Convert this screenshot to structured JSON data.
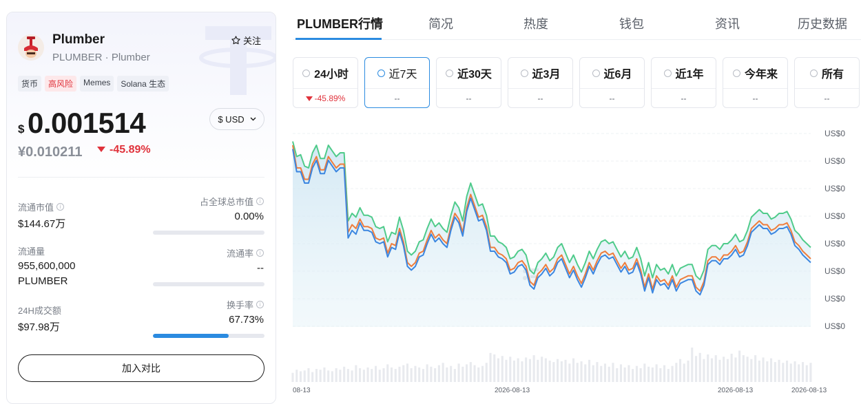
{
  "coin": {
    "name": "Plumber",
    "subtitle": "PLUMBER · Plumber",
    "follow_label": "关注",
    "tags": [
      {
        "label": "货币",
        "kind": "normal"
      },
      {
        "label": "高风险",
        "kind": "risk"
      },
      {
        "label": "Memes",
        "kind": "normal"
      },
      {
        "label": "Solana 生态",
        "kind": "normal"
      }
    ],
    "currency_symbol": "$",
    "price": "0.001514",
    "currency_select": "$ USD",
    "price_cny": "¥0.010211",
    "change_24h": "-45.89%"
  },
  "stats": {
    "market_cap_label": "流通市值",
    "market_cap_value": "$144.67万",
    "global_share_label": "占全球总市值",
    "global_share_value": "0.00%",
    "global_share_progress": 0,
    "circulating_label": "流通量",
    "circulating_value_1": "955,600,000",
    "circulating_value_2": "PLUMBER",
    "circulating_rate_label": "流通率",
    "circulating_rate_value": "--",
    "circulating_rate_progress": 0,
    "volume_label": "24H成交额",
    "volume_value": "$97.98万",
    "turnover_label": "换手率",
    "turnover_value": "67.73%",
    "turnover_progress": 0.6773
  },
  "compare_button": "加入对比",
  "tabs": [
    {
      "label": "PLUMBER行情",
      "active": true
    },
    {
      "label": "简况",
      "active": false
    },
    {
      "label": "热度",
      "active": false
    },
    {
      "label": "钱包",
      "active": false
    },
    {
      "label": "资讯",
      "active": false
    },
    {
      "label": "历史数据",
      "active": false
    }
  ],
  "periods": [
    {
      "label": "24小时",
      "value": "-45.89%",
      "negative": true,
      "active": false
    },
    {
      "label": "近7天",
      "value": "--",
      "negative": false,
      "active": true
    },
    {
      "label": "近30天",
      "value": "--",
      "negative": false,
      "active": false
    },
    {
      "label": "近3月",
      "value": "--",
      "negative": false,
      "active": false
    },
    {
      "label": "近6月",
      "value": "--",
      "negative": false,
      "active": false
    },
    {
      "label": "近1年",
      "value": "--",
      "negative": false,
      "active": false
    },
    {
      "label": "今年来",
      "value": "--",
      "negative": false,
      "active": false
    },
    {
      "label": "所有",
      "value": "--",
      "negative": false,
      "active": false
    }
  ],
  "colors": {
    "accent": "#2b8be0",
    "negative": "#e0323b",
    "line_green": "#4fcb8a",
    "line_orange": "#ef7d3c",
    "line_blue": "#3b86e0"
  },
  "chart_data": {
    "type": "line",
    "y_tick_labels": [
      "US$0",
      "US$0",
      "US$0",
      "US$0",
      "US$0",
      "US$0",
      "US$0",
      "US$0"
    ],
    "x_tick_labels": [
      "08-13",
      "2026-08-13",
      "2026-08-13",
      "2026-08-13"
    ],
    "grid": true,
    "series": [
      {
        "color": "#4fcb8a",
        "values": [
          98,
          90,
          91,
          85,
          84,
          92,
          96,
          89,
          89,
          96,
          93,
          90,
          92,
          92,
          56,
          60,
          58,
          63,
          59,
          59,
          58,
          53,
          52,
          53,
          45,
          50,
          49,
          58,
          51,
          40,
          38,
          40,
          45,
          46,
          52,
          57,
          53,
          55,
          52,
          50,
          59,
          66,
          63,
          56,
          69,
          76,
          70,
          64,
          65,
          59,
          48,
          48,
          45,
          44,
          42,
          36,
          37,
          40,
          41,
          38,
          30,
          28,
          34,
          36,
          39,
          35,
          37,
          42,
          44,
          39,
          34,
          38,
          33,
          29,
          34,
          40,
          36,
          41,
          45,
          46,
          44,
          45,
          41,
          37,
          40,
          36,
          37,
          42,
          36,
          27,
          34,
          26,
          33,
          30,
          31,
          28,
          33,
          27,
          31,
          32,
          33,
          33,
          27,
          25,
          30,
          41,
          43,
          43,
          41,
          44,
          44,
          46,
          49,
          45,
          46,
          51,
          58,
          60,
          62,
          60,
          60,
          57,
          58,
          60,
          60,
          61,
          57,
          51,
          49,
          46,
          44,
          42
        ]
      },
      {
        "color": "#ef7d3c",
        "values": [
          96,
          84,
          84,
          78,
          78,
          86,
          90,
          83,
          83,
          90,
          87,
          84,
          86,
          86,
          50,
          54,
          52,
          57,
          53,
          53,
          52,
          47,
          46,
          47,
          39,
          44,
          43,
          52,
          45,
          34,
          32,
          34,
          39,
          40,
          46,
          51,
          47,
          49,
          46,
          44,
          53,
          60,
          57,
          50,
          63,
          70,
          64,
          58,
          59,
          53,
          42,
          42,
          39,
          38,
          36,
          30,
          31,
          34,
          35,
          32,
          24,
          22,
          28,
          30,
          33,
          29,
          31,
          36,
          38,
          33,
          28,
          32,
          27,
          23,
          28,
          34,
          30,
          35,
          39,
          40,
          38,
          39,
          35,
          31,
          34,
          30,
          31,
          36,
          30,
          21,
          28,
          20,
          27,
          24,
          25,
          22,
          27,
          21,
          25,
          26,
          27,
          27,
          21,
          19,
          24,
          35,
          37,
          37,
          35,
          38,
          38,
          40,
          43,
          39,
          40,
          45,
          52,
          54,
          56,
          54,
          54,
          51,
          52,
          54,
          54,
          55,
          51,
          45,
          43,
          40,
          38,
          36
        ]
      },
      {
        "color": "#3b86e0",
        "values": [
          94,
          82,
          82,
          76,
          76,
          84,
          88,
          81,
          81,
          88,
          85,
          82,
          84,
          84,
          47,
          51,
          49,
          55,
          51,
          51,
          50,
          45,
          44,
          45,
          37,
          42,
          41,
          50,
          43,
          32,
          30,
          32,
          37,
          38,
          44,
          49,
          45,
          47,
          44,
          42,
          51,
          58,
          55,
          48,
          61,
          68,
          62,
          56,
          57,
          51,
          40,
          40,
          37,
          36,
          34,
          28,
          29,
          32,
          33,
          30,
          22,
          20,
          26,
          28,
          31,
          27,
          29,
          34,
          36,
          31,
          26,
          30,
          25,
          21,
          26,
          32,
          28,
          33,
          37,
          38,
          36,
          37,
          33,
          29,
          32,
          28,
          29,
          34,
          28,
          19,
          26,
          18,
          25,
          22,
          23,
          20,
          25,
          19,
          23,
          24,
          25,
          25,
          19,
          17,
          22,
          33,
          35,
          35,
          33,
          36,
          36,
          38,
          41,
          37,
          38,
          43,
          50,
          52,
          54,
          52,
          52,
          49,
          50,
          52,
          52,
          53,
          49,
          43,
          41,
          38,
          36,
          34
        ]
      }
    ],
    "volume": [
      12,
      16,
      14,
      15,
      18,
      13,
      17,
      16,
      19,
      15,
      14,
      18,
      16,
      20,
      17,
      15,
      22,
      18,
      16,
      19,
      17,
      21,
      16,
      18,
      23,
      19,
      17,
      20,
      22,
      24,
      18,
      21,
      19,
      17,
      23,
      20,
      18,
      22,
      25,
      19,
      21,
      17,
      24,
      20,
      23,
      26,
      22,
      19,
      21,
      25,
      38,
      36,
      31,
      34,
      29,
      33,
      28,
      31,
      27,
      32,
      30,
      35,
      29,
      33,
      31,
      28,
      26,
      30,
      27,
      29,
      24,
      31,
      25,
      27,
      23,
      29,
      22,
      26,
      21,
      24,
      20,
      25,
      18,
      23,
      19,
      22,
      17,
      21,
      18,
      24,
      20,
      19,
      23,
      18,
      22,
      17,
      21,
      25,
      30,
      24,
      28,
      45,
      34,
      38,
      30,
      36,
      31,
      35,
      29,
      33,
      30,
      37,
      32,
      41,
      35,
      33,
      30,
      35,
      28,
      32,
      27,
      31,
      26,
      29,
      25,
      28,
      24,
      27,
      23,
      26,
      22,
      25
    ]
  }
}
